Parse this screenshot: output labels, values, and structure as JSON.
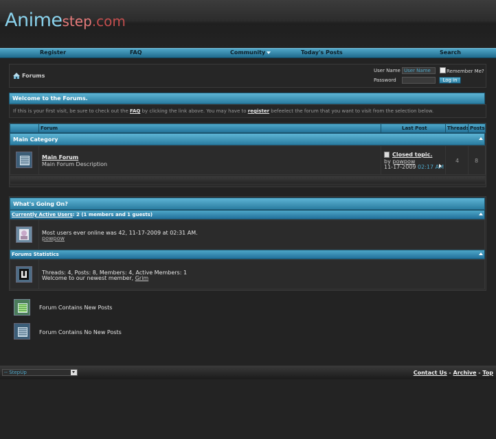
{
  "header": {
    "logo_part1": "Anime",
    "logo_part2": "step",
    "logo_part3": ".com"
  },
  "nav": {
    "register": "Register",
    "faq": "FAQ",
    "community": "Community",
    "todays_posts": "Today's Posts",
    "search": "Search"
  },
  "breadcrumb": {
    "title": "Forums"
  },
  "login": {
    "username_label": "User Name",
    "username_placeholder": "User Name",
    "remember_label": "Remember Me?",
    "password_label": "Password",
    "login_button": "Log in"
  },
  "welcome": {
    "title": "Welcome to the Forums.",
    "text_1": "If this is your first visit, be sure to check out the ",
    "faq_link": "FAQ",
    "text_2": " by clicking the link above. You may have to ",
    "register_link": "register",
    "text_3": " befeelect the forum that you want to visit from the selection below."
  },
  "forum_table": {
    "columns": {
      "forum": "Forum",
      "last_post": "Last Post",
      "threads": "Threads",
      "posts": "Posts"
    },
    "category": "Main Category",
    "forum": {
      "name": "Main Forum",
      "description": "Main Forum Description",
      "last_post_title": "Closed topic.",
      "last_post_by_label": "by",
      "last_post_user": "powpow",
      "last_post_date": "11-17-2009",
      "last_post_time": "02:17 AM",
      "threads": "4",
      "posts": "8"
    }
  },
  "whats_going_on": {
    "title": "What's Going On?",
    "active_users_link": "Currently Active Users",
    "active_users_count": ": 2 (1 members and 1 guests)",
    "most_users_text": "Most users ever online was 42, 11-17-2009 at 02:31 AM.",
    "online_user": "powpow",
    "stats_title": "Forums Statistics",
    "stats_line": "Threads: 4, Posts: 8, Members: 4, Active Members: 1",
    "newest_member_text": "Welcome to our newest member, ",
    "newest_member": "Grim"
  },
  "legend": {
    "new_posts": "Forum Contains New Posts",
    "no_new_posts": "Forum Contains No New Posts"
  },
  "footer": {
    "style_select": "-- StepUp",
    "contact_us": "Contact Us",
    "separator": " - ",
    "archive": "Archive",
    "top": "Top"
  }
}
